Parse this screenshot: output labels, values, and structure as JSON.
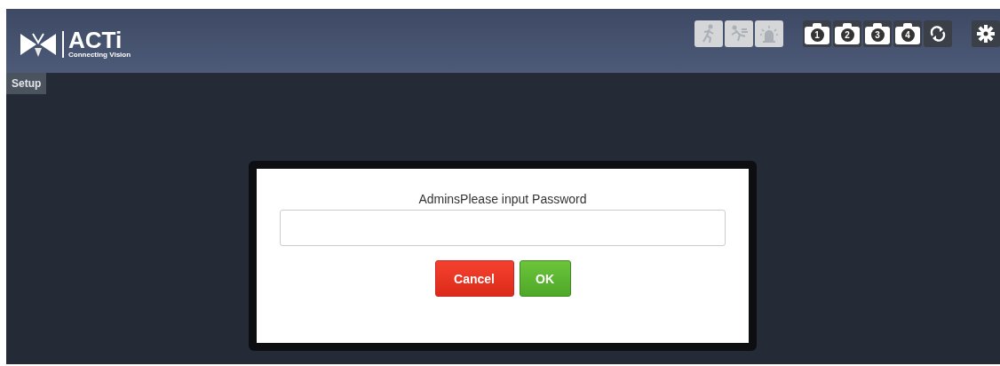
{
  "header": {
    "logo": {
      "name": "ACTi",
      "tagline": "Connecting Vision"
    },
    "toolbar": [
      {
        "kind": "motion",
        "disabled": true
      },
      {
        "kind": "tamper",
        "disabled": true
      },
      {
        "kind": "alarm",
        "disabled": true
      },
      {
        "kind": "snapshot",
        "label": "1",
        "disabled": false
      },
      {
        "kind": "snapshot",
        "label": "2",
        "disabled": false
      },
      {
        "kind": "snapshot",
        "label": "3",
        "disabled": false
      },
      {
        "kind": "snapshot",
        "label": "4",
        "disabled": false
      },
      {
        "kind": "refresh",
        "disabled": false
      },
      {
        "kind": "settings",
        "disabled": false
      }
    ]
  },
  "tabs": [
    {
      "label": "Setup",
      "selected": true
    }
  ],
  "dialog": {
    "title": "AdminsPlease input Password",
    "buttons": [
      {
        "label": "Cancel",
        "kind": "cancel"
      },
      {
        "label": "OK",
        "kind": "ok"
      }
    ]
  }
}
